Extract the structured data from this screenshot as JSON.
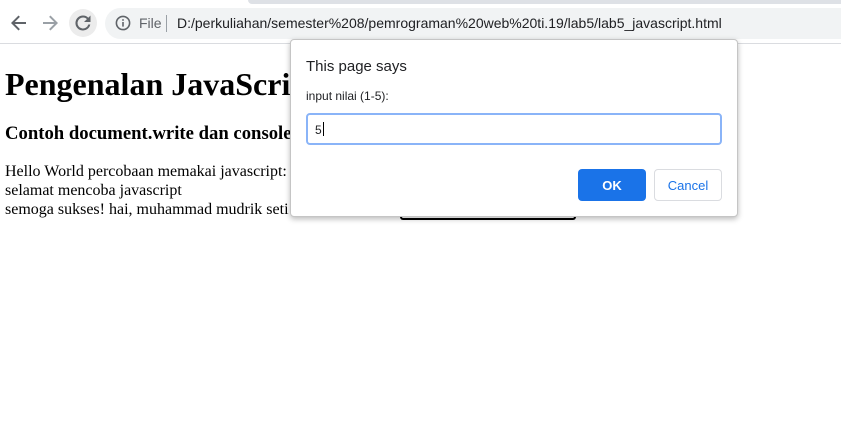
{
  "browser": {
    "address_bar": {
      "scheme_label": "File",
      "url": "D:/perkuliahan/semester%208/pemrograman%20web%20ti.19/lab5/lab5_javascript.html"
    },
    "icons": {
      "back": "arrow-left",
      "forward": "arrow-right",
      "reload": "reload",
      "site_info": "info-circle"
    }
  },
  "page": {
    "heading": "Pengenalan JavaScript",
    "subheading": "Contoh document.write dan console",
    "lines": [
      "Hello World percobaan memakai javascript:",
      "selamat mencoba javascript",
      "semoga sukses! hai, muhammad mudrik seti"
    ]
  },
  "dialog": {
    "title": "This page says",
    "message": "input nilai (1-5):",
    "input_value": "5",
    "ok_label": "OK",
    "cancel_label": "Cancel"
  },
  "colors": {
    "ok_button": "#1a73e8",
    "input_focus_border": "#8ab4f8",
    "omnibox_bg": "#f1f3f4"
  }
}
